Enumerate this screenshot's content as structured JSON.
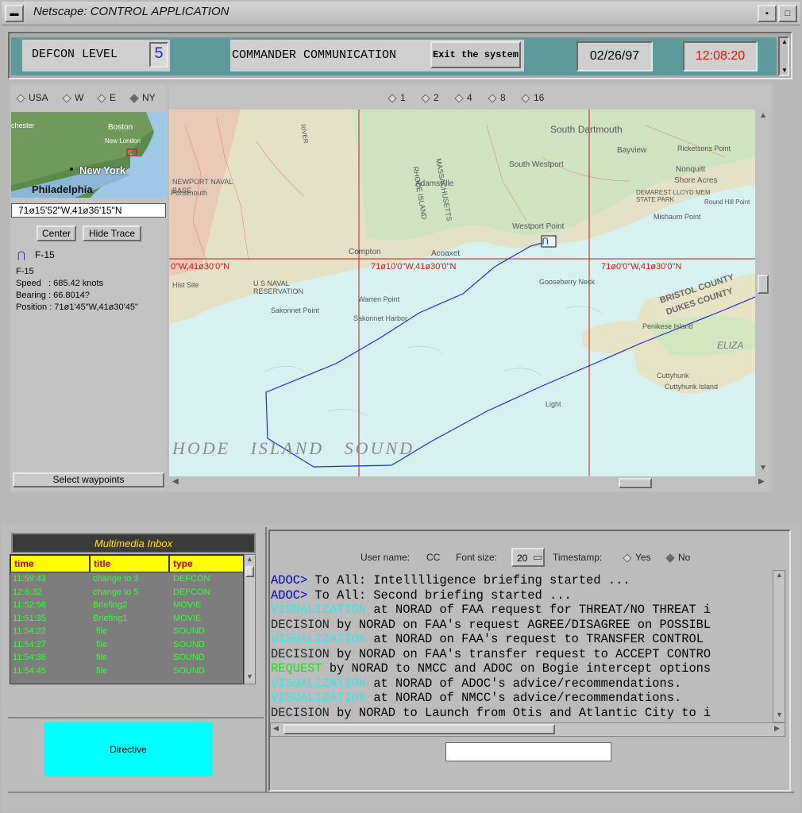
{
  "window": {
    "title": "Netscape: CONTROL APPLICATION"
  },
  "topbar": {
    "defcon_label": "DEFCON LEVEL",
    "defcon_value": "5",
    "commander_label": "COMMANDER COMMUNICATION",
    "exit_button": "Exit the system",
    "date": "02/26/97",
    "time": "12:08:20"
  },
  "region_selector": {
    "options": [
      "USA",
      "W",
      "E",
      "NY"
    ],
    "selected": "NY"
  },
  "minimap": {
    "labels": [
      "chester",
      "Boston",
      "New London",
      "New York",
      "Philadelphia"
    ]
  },
  "coordinates": "71ø15'52\"W,41ø36'15\"N",
  "buttons": {
    "center": "Center",
    "hide_trace": "Hide Trace",
    "select_waypoints": "Select waypoints"
  },
  "selected_aircraft": {
    "name": "F-15",
    "title": "F-15",
    "speed": "Speed   : 685.42 knots",
    "bearing": "Bearing : 66.8014?",
    "position": "Position : 71ø1'45\"W,41ø30'45\""
  },
  "zoom": {
    "options": [
      "1",
      "2",
      "4",
      "8",
      "16"
    ]
  },
  "map": {
    "gridlabels": [
      "0\"W,41ø30'0\"N",
      "71ø10'0\"W,41ø30'0\"N",
      "71ø0'0\"W,41ø30'0\"N"
    ],
    "placenames": [
      "South Dartmouth",
      "Bayview",
      "Ricketsons Point",
      "Nonquitt",
      "Shore Acres",
      "Round Hill Point",
      "DEMAREST LLOYD MEM STATE PARK",
      "Mishaum Point",
      "South Westport",
      "Westport Point",
      "Adamsville",
      "Acoaxet",
      "Gooseberry Neck",
      "Compton",
      "Portsmouth",
      "NEWPORT NAVAL BASE",
      "U S NAVAL RESERVATION",
      "Sakonnet Point",
      "BRISTOL COUNTY",
      "DUKES COUNTY",
      "Penikese Island",
      "Cuttyhunk",
      "Cuttyhunk Island",
      "Light",
      "ELIZA",
      "RHODE ISLAND",
      "MASSACHUSETTS",
      "RIVER",
      "Warren Point",
      "Sakonnet Harbor",
      "Hist Site"
    ],
    "sound_label": "HODE   ISLAND   SOUND",
    "marker": "F-15"
  },
  "inbox": {
    "title": "Multimedia Inbox",
    "columns": [
      "time",
      "title",
      "type"
    ],
    "rows": [
      [
        "11:59:43",
        "change to 3",
        "DEFCON"
      ],
      [
        "12:6:32",
        "change to 5",
        "DEFCON"
      ],
      [
        "11:52:56",
        "Briefing2",
        "MOVIE"
      ],
      [
        "11:51:35",
        "Briefing1",
        "MOVIE"
      ],
      [
        "11:54:22",
        "file",
        "SOUND"
      ],
      [
        "11:54:27",
        "file",
        "SOUND"
      ],
      [
        "11:54:36",
        "file",
        "SOUND"
      ],
      [
        "11:54:45",
        "file",
        "SOUND"
      ]
    ]
  },
  "directive": {
    "label": "Directive"
  },
  "chat": {
    "user_label": "User name:",
    "user_value": "CC",
    "font_label": "Font size:",
    "font_value": "20",
    "timestamp_label": "Timestamp:",
    "timestamp_yes": "Yes",
    "timestamp_no": "No",
    "lines": [
      {
        "prefix": "ADOC>",
        "text": " To All: Intelllligence briefing started ...",
        "color": "#0000cc"
      },
      {
        "prefix": "ADOC>",
        "text": " To All: Second briefing started ...",
        "color": "#0000cc"
      },
      {
        "prefix": "VISUALIZATION",
        "text": " at NORAD of FAA request for THREAT/NO THREAT i",
        "color": "#33e8e8"
      },
      {
        "prefix": "DECISION",
        "text": " by NORAD on FAA's request AGREE/DISAGREE on POSSIBL",
        "color": "#222222"
      },
      {
        "prefix": "VISUALIZATION",
        "text": " at NORAD on FAA's request to TRANSFER CONTROL",
        "color": "#33e8e8"
      },
      {
        "prefix": "DECISION",
        "text": " by NORAD on FAA's transfer request to ACCEPT CONTRO",
        "color": "#222222"
      },
      {
        "prefix": "REQUEST",
        "text": " by NORAD to NMCC and ADOC on Bogie intercept options",
        "color": "#22dd22"
      },
      {
        "prefix": "VISUALIZATION",
        "text": " at NORAD of ADOC's advice/recommendations.",
        "color": "#33e8e8"
      },
      {
        "prefix": "VISUALIZATION",
        "text": " at NORAD of NMCC's advice/recommendations.",
        "color": "#33e8e8"
      },
      {
        "prefix": "DECISION",
        "text": " by NORAD to Launch from Otis and Atlantic City to i",
        "color": "#222222"
      }
    ]
  }
}
